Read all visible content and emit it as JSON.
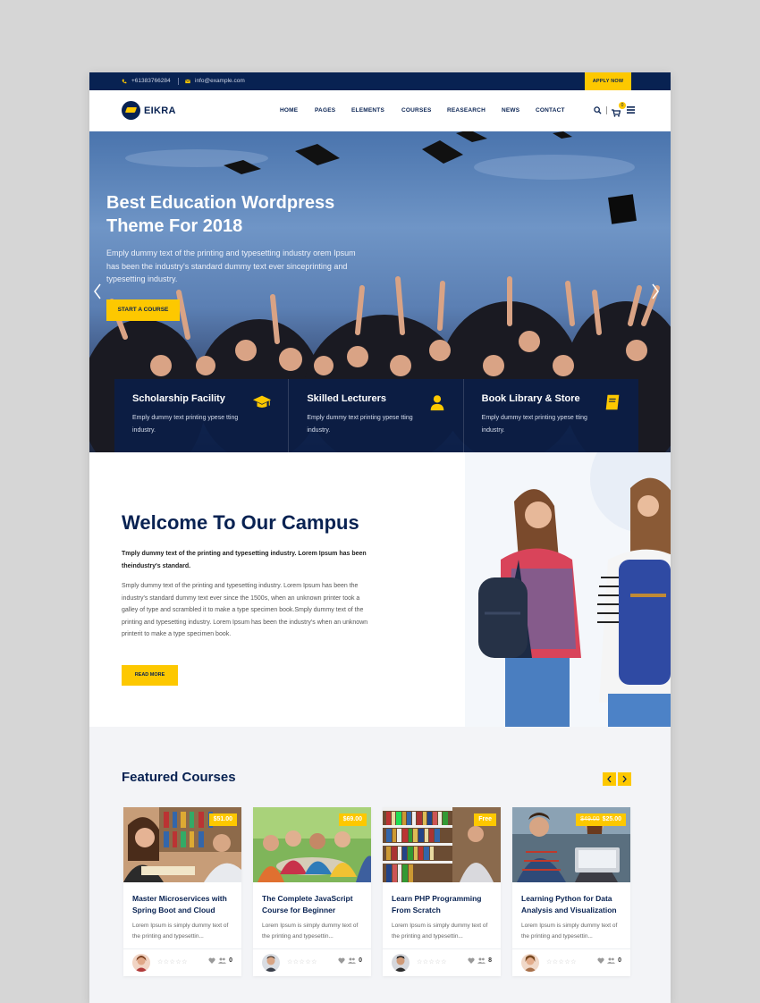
{
  "topbar": {
    "phone": "+61383766284",
    "email": "info@example.com",
    "apply_label": "APPLY NOW"
  },
  "brand": {
    "name": "EIKRA"
  },
  "nav": {
    "items": [
      "HOME",
      "PAGES",
      "ELEMENTS",
      "COURSES",
      "REASEARCH",
      "NEWS",
      "CONTACT"
    ],
    "cart_count": "0"
  },
  "hero": {
    "title": "Best Education Wordpress Theme For 2018",
    "description": "Emply dummy text of the printing and typesetting industry orem Ipsum has been the industry's standard dummy text ever sinceprinting and typesetting industry.",
    "cta_label": "START A COURSE"
  },
  "features": [
    {
      "title": "Scholarship Facility",
      "text": "Emply dummy text printing ypese tting industry.",
      "icon": "graduation-cap-icon"
    },
    {
      "title": "Skilled Lecturers",
      "text": "Emply dummy text printing ypese tting industry.",
      "icon": "user-icon"
    },
    {
      "title": "Book Library & Store",
      "text": "Emply dummy text printing ypese tting industry.",
      "icon": "book-icon"
    }
  ],
  "welcome": {
    "title": "Welcome To Our Campus",
    "lead": "Tmply dummy text of the printing and typesetting industry. Lorem Ipsum has been theindustry's standard.",
    "body": "Smply dummy text of the printing and typesetting industry. Lorem Ipsum has been the industry's standard dummy text ever since the 1500s, when an unknown printer took a galley of type and scrambled it to make a type specimen book.Smply dummy text of the printing and typesetting industry. Lorem Ipsum has been the industry's when an unknown printerit to make a type specimen book.",
    "button_label": "READ MORE"
  },
  "courses": {
    "title": "Featured Courses",
    "prev_icon": "chevron-left-icon",
    "next_icon": "chevron-right-icon",
    "items": [
      {
        "title": "Master Microservices with Spring Boot and Cloud",
        "price": "$51.00",
        "old_price": "",
        "desc": "Lorem Ipsum is simply dummy text of the printing and typesettin...",
        "stars": "☆☆☆☆☆",
        "count": "0"
      },
      {
        "title": "The Complete JavaScript Course for Beginner",
        "price": "$69.00",
        "old_price": "",
        "desc": "Lorem Ipsum is simply dummy text of the printing and typesettin...",
        "stars": "☆☆☆☆☆",
        "count": "0"
      },
      {
        "title": "Learn PHP Programming From Scratch",
        "price": "Free",
        "old_price": "",
        "desc": "Lorem Ipsum is simply dummy text of the printing and typesettin...",
        "stars": "☆☆☆☆☆",
        "count": "8"
      },
      {
        "title": "Learning Python for Data Analysis and Visualization",
        "price": "$25.00",
        "old_price": "$49.00",
        "desc": "Lorem Ipsum is simply dummy text of the printing and typesettin...",
        "stars": "☆☆☆☆☆",
        "count": "0"
      }
    ]
  },
  "colors": {
    "navy": "#082252",
    "accent": "#fdc800"
  }
}
